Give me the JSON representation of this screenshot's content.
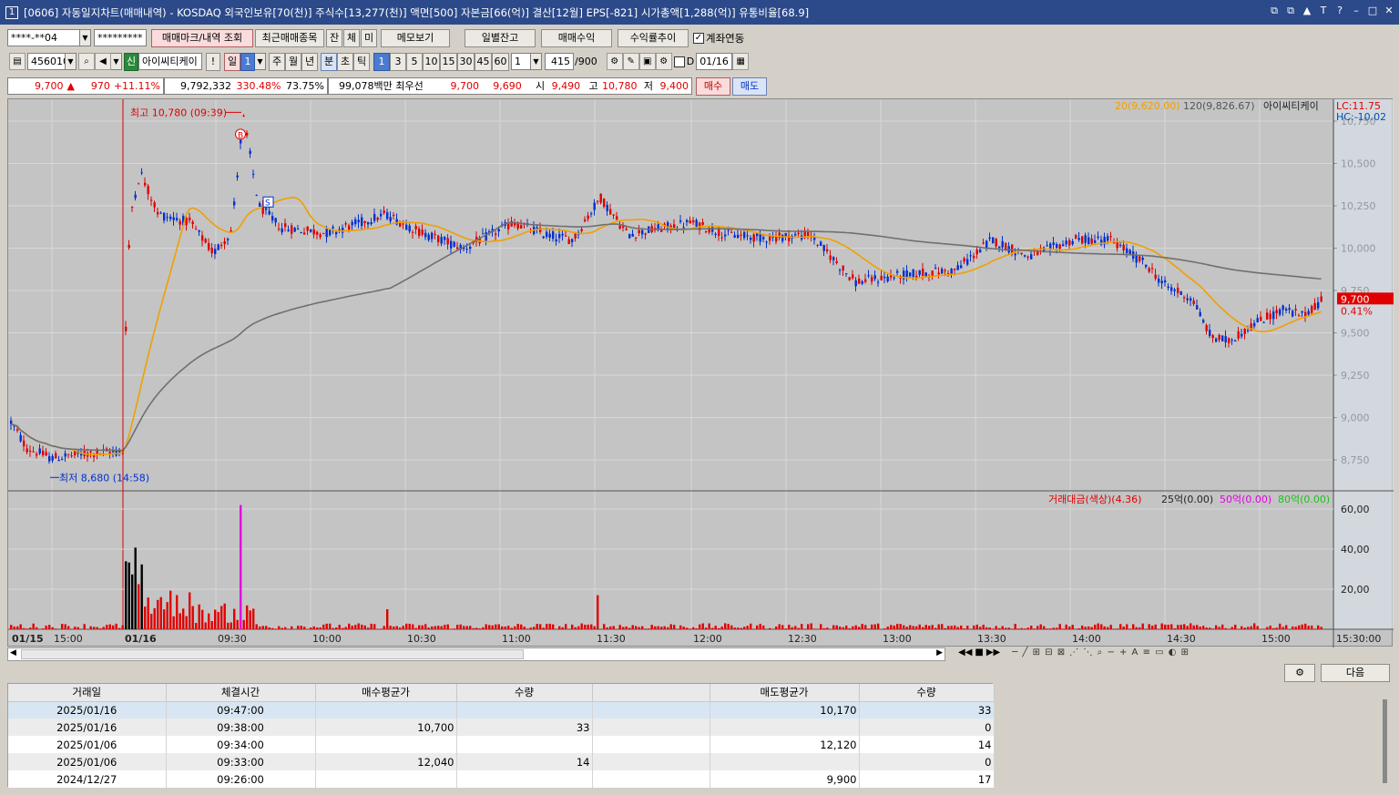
{
  "title": {
    "num_icon": "1",
    "text": "[0606] 자동일지차트(매매내역) - KOSDAQ 외국인보유[70(천)] 주식수[13,277(천)] 액면[500] 자본금[66(억)] 결산[12월] EPS[-821] 시가총액[1,288(억)] 유통비율[68.9]",
    "buttons": [
      "⧉",
      "⧉",
      "▲",
      "T",
      "?",
      "–",
      "□",
      "✕"
    ]
  },
  "toolbar1": {
    "account": "****-**04",
    "password": "*********",
    "trade_mark_btn": "매매마크/내역 조회",
    "recent_btn": "최근매매종목",
    "jan": "잔",
    "che": "체",
    "mi": "미",
    "memo_btn": "메모보기",
    "daily_btn": "일별잔고",
    "trade_profit_btn": "매매수익",
    "profit_trend_btn": "수익률추이",
    "link_label": "계좌연동"
  },
  "toolbar2": {
    "code": "456010",
    "sin": "신",
    "stock_name": "아이씨티케이",
    "excl": "!",
    "period_il": "일",
    "period_num": "1",
    "ju": "주",
    "wol": "월",
    "nyeon": "년",
    "bun": "분",
    "cho": "초",
    "tik": "틱",
    "intervals": [
      "1",
      "3",
      "5",
      "10",
      "15",
      "30",
      "45",
      "60"
    ],
    "interval_input": "1",
    "count": "415",
    "count_total": "/900",
    "d_label": "D",
    "date": "01/16"
  },
  "quote": {
    "price": "9,700",
    "arrow": "▲",
    "change": "970",
    "change_pct": "+11.11%",
    "volume": "9,792,332",
    "vol_ratio": "330.48%",
    "turnover": "73.75%",
    "amount": "99,078백만",
    "best_label": "최우선",
    "best_ask": "9,700",
    "best_bid": "9,690",
    "open_label": "시",
    "open": "9,490",
    "high_label": "고",
    "high": "10,780",
    "low_label": "저",
    "low": "9,400",
    "buy_btn": "매수",
    "sell_btn": "매도"
  },
  "chart": {
    "stock": "아이씨티케이",
    "ma20_label": "20(9,620.00)",
    "ma120_label": "120(9,826.67)",
    "lc": "LC:11.75",
    "hc": "HC:-10.02",
    "high_annot": "최고 10,780 (09:39)",
    "low_annot": "최저 8,680 (14:58)",
    "mark_buy": "B",
    "mark_sell": "S",
    "price_tag": "9,700",
    "pct_tag": "0.41%",
    "y_ticks": [
      "10,750",
      "10,500",
      "10,250",
      "10,000",
      "9,750",
      "9,500",
      "9,250",
      "9,000",
      "8,750"
    ],
    "vol_title": "거래대금(색상)(4.36)",
    "vol_25": "25억(0.00)",
    "vol_50": "50억(0.00)",
    "vol_80": "80억(0.00)",
    "vol_ticks": [
      "60,00",
      "40,00",
      "20,00"
    ],
    "x_labels": [
      "01/15",
      "15:00",
      "01/16",
      "09:30",
      "10:00",
      "10:30",
      "11:00",
      "11:30",
      "12:00",
      "12:30",
      "13:00",
      "13:30",
      "14:00",
      "14:30",
      "15:00",
      "15:30:00"
    ],
    "colors": {
      "up": "#e00000",
      "down": "#0030d0",
      "ma20": "#f0a000",
      "ma120": "#707070",
      "bg": "#c4c4c4"
    }
  },
  "bottom": {
    "next_btn": "다음",
    "gear": "gear-icon"
  },
  "table": {
    "headers": [
      "거래일",
      "체결시간",
      "매수평균가",
      "수량",
      "",
      "매도평균가",
      "수량"
    ],
    "rows": [
      [
        "2025/01/16",
        "09:47:00",
        "",
        "",
        "",
        "10,170",
        "33"
      ],
      [
        "2025/01/16",
        "09:38:00",
        "10,700",
        "33",
        "",
        "",
        "0"
      ],
      [
        "2025/01/06",
        "09:34:00",
        "",
        "",
        "",
        "12,120",
        "14"
      ],
      [
        "2025/01/06",
        "09:33:00",
        "12,040",
        "14",
        "",
        "",
        "0"
      ],
      [
        "2024/12/27",
        "09:26:00",
        "",
        "",
        "",
        "9,900",
        "17"
      ]
    ]
  }
}
